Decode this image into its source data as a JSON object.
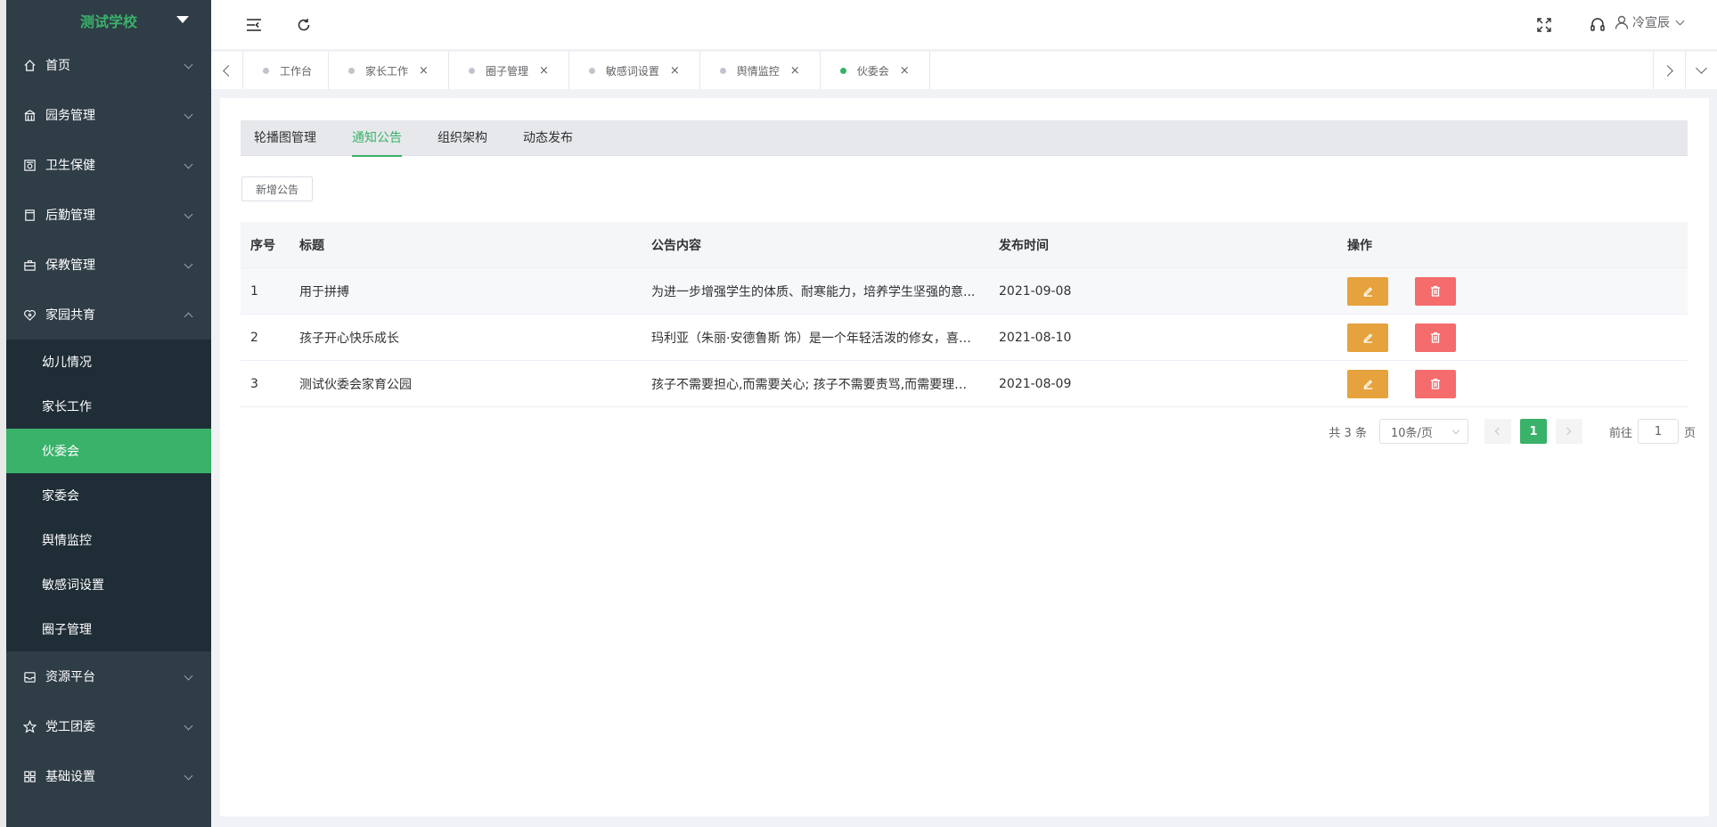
{
  "sidebar": {
    "school_name": "测试学校",
    "menu": [
      {
        "label": "首页",
        "icon": "home-icon"
      },
      {
        "label": "园务管理",
        "icon": "building-icon"
      },
      {
        "label": "卫生保健",
        "icon": "health-icon"
      },
      {
        "label": "后勤管理",
        "icon": "logistics-icon"
      },
      {
        "label": "保教管理",
        "icon": "bag-icon"
      },
      {
        "label": "家园共育",
        "icon": "heart-icon"
      }
    ],
    "submenu": [
      "幼儿情况",
      "家长工作",
      "伙委会",
      "家委会",
      "舆情监控",
      "敏感词设置",
      "圈子管理"
    ],
    "menu_after": [
      {
        "label": "资源平台",
        "icon": "inbox-icon"
      },
      {
        "label": "党工团委",
        "icon": "star-icon"
      },
      {
        "label": "基础设置",
        "icon": "grid-icon"
      }
    ],
    "active_sub": "伙委会"
  },
  "header": {
    "username": "冷宣辰"
  },
  "tabs": [
    {
      "label": "工作台",
      "closable": false
    },
    {
      "label": "家长工作",
      "closable": true
    },
    {
      "label": "圈子管理",
      "closable": true
    },
    {
      "label": "敏感词设置",
      "closable": true
    },
    {
      "label": "舆情监控",
      "closable": true
    },
    {
      "label": "伙委会",
      "closable": true,
      "active": true
    }
  ],
  "subtabs": [
    "轮播图管理",
    "通知公告",
    "组织架构",
    "动态发布"
  ],
  "active_subtab": "通知公告",
  "add_button": "新增公告",
  "table": {
    "headers": [
      "序号",
      "标题",
      "公告内容",
      "发布时间",
      "操作"
    ],
    "rows": [
      {
        "no": "1",
        "title": "用于拼搏",
        "content": "为进一步增强学生的体质、耐寒能力，培养学生坚强的意...",
        "date": "2021-09-08"
      },
      {
        "no": "2",
        "title": "孩子开心快乐成长",
        "content": "玛利亚（朱丽·安德鲁斯 饰）是一个年轻活泼的修女，喜欢...",
        "date": "2021-08-10"
      },
      {
        "no": "3",
        "title": "测试伙委会家育公园",
        "content": "孩子不需要担心,而需要关心; 孩子不需要责骂,而需要理解; ...",
        "date": "2021-08-09"
      }
    ]
  },
  "pagination": {
    "total_text": "共 3 条",
    "page_size": "10条/页",
    "current_page": "1",
    "goto_label": "前往",
    "goto_value": "1",
    "page_unit": "页"
  },
  "colors": {
    "accent": "#3ab26a",
    "sidebar_bg": "#2f3d47",
    "submenu_bg": "#1f2d36",
    "edit_btn": "#e6a23c",
    "delete_btn": "#f56c6c"
  }
}
